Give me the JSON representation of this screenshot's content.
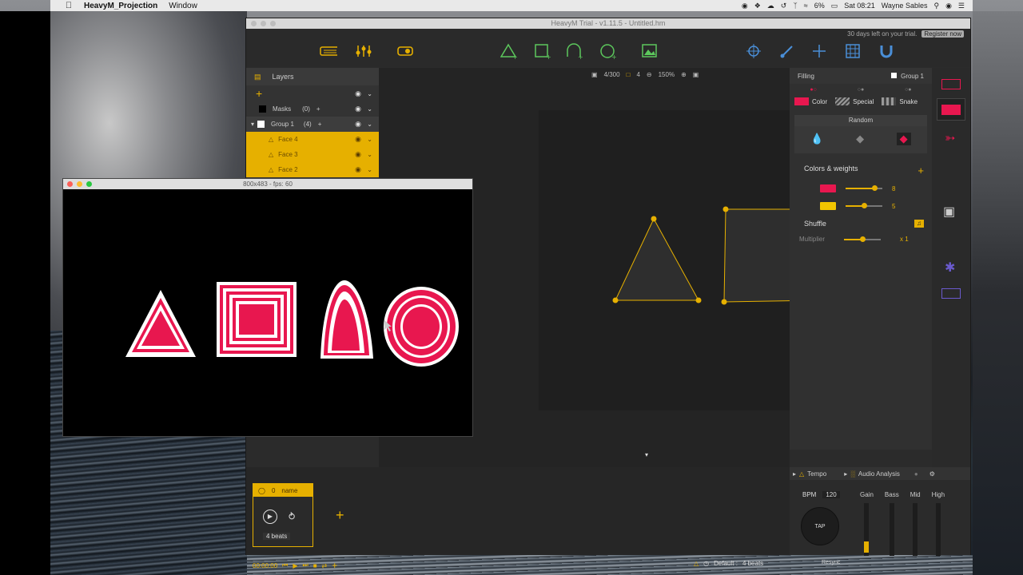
{
  "menubar": {
    "app_name": "HeavyM_Projection",
    "menu_window": "Window",
    "battery": "6%",
    "clock": "Sat 08:21",
    "user": "Wayne Sables"
  },
  "main_window": {
    "title": "HeavyM Trial - v1.11.5 - Untitled.hm",
    "trial_text": "30 days left on your trial.",
    "register_button": "Register now"
  },
  "layers": {
    "title": "Layers",
    "rows": [
      {
        "name": "Masks",
        "count": "(0)"
      },
      {
        "name": "Group 1",
        "count": "(4)"
      },
      {
        "name": "Face 4",
        "count": ""
      },
      {
        "name": "Face 3",
        "count": ""
      },
      {
        "name": "Face 2",
        "count": ""
      }
    ]
  },
  "canvas": {
    "face_count": "4/300",
    "faces_selected": "4",
    "zoom": "150%"
  },
  "filling": {
    "title": "Filling",
    "group_label": "Group 1",
    "tabs": [
      "Color",
      "Special",
      "Snake"
    ],
    "random_label": "Random",
    "colors_weights_label": "Colors & weights",
    "weights": [
      {
        "color": "#e8174f",
        "value": "8",
        "fraction": 0.8
      },
      {
        "color": "#f2c500",
        "value": "5",
        "fraction": 0.5
      }
    ],
    "shuffle_label": "Shuffle",
    "multiplier_label": "Multiplier",
    "multiplier_value": "x 1",
    "multiplier_fraction": 0.5
  },
  "sequencer": {
    "cue_index": "0",
    "cue_name": "name",
    "cue_beats": "4 beats",
    "timecode": "00:00:00",
    "default_label": "Default :",
    "default_value": "4 beats"
  },
  "tempo": {
    "tempo_label": "Tempo",
    "audio_label": "Audio Analysis",
    "bpm_label": "BPM",
    "bpm_value": "120",
    "tap_label": "TAP",
    "bands": [
      "Gain",
      "Bass",
      "Mid",
      "High"
    ],
    "resync_label": "Resync"
  },
  "preview": {
    "title": "800x483 - fps: 60"
  },
  "colors": {
    "accent": "#e6b000",
    "fill_red": "#e8174f",
    "accent_green": "#5cc85c",
    "accent_blue": "#4a8fd8",
    "accent_purple": "#6a5acd"
  }
}
